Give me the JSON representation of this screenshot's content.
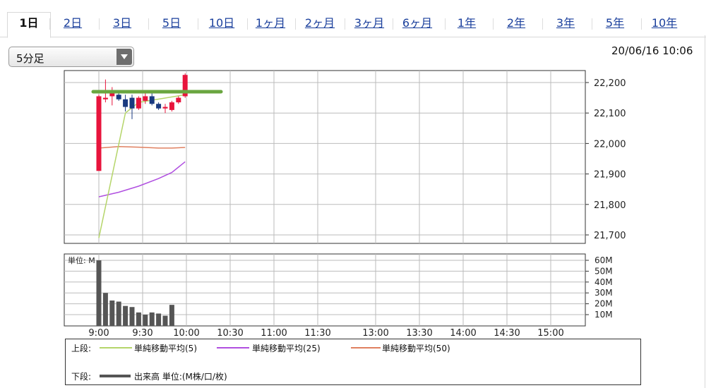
{
  "tabs": [
    {
      "label": "1日",
      "active": true
    },
    {
      "label": "2日"
    },
    {
      "label": "3日"
    },
    {
      "label": "5日"
    },
    {
      "label": "10日"
    },
    {
      "label": "1ヶ月"
    },
    {
      "label": "2ヶ月"
    },
    {
      "label": "3ヶ月"
    },
    {
      "label": "6ヶ月"
    },
    {
      "label": "1年"
    },
    {
      "label": "2年"
    },
    {
      "label": "3年"
    },
    {
      "label": "5年"
    },
    {
      "label": "10年"
    }
  ],
  "interval_select": {
    "value": "5分足"
  },
  "timestamp": "20/06/16 10:06",
  "legend": {
    "upper_label": "上段:",
    "lower_label": "下段:",
    "ma5": "単純移動平均(5)",
    "ma25": "単純移動平均(25)",
    "ma50": "単純移動平均(50)",
    "volume": "出来高 単位:(M株/口/枚)"
  },
  "colors": {
    "up": "#e8143c",
    "down": "#1a3a80",
    "ma5": "#b5d56a",
    "ma25": "#b04fe0",
    "ma50": "#e08060",
    "volume": "#555555",
    "highlight": "#6aa640"
  },
  "chart_data": [
    {
      "type": "candlestick",
      "x_ticks": [
        "9:00",
        "9:30",
        "10:00",
        "10:30",
        "11:00",
        "11:30",
        "13:00",
        "13:30",
        "14:00",
        "14:30",
        "15:00"
      ],
      "y_ticks": [
        "22,200",
        "22,100",
        "22,000",
        "21,900",
        "21,800",
        "21,700"
      ],
      "ylim": [
        21680,
        22240
      ],
      "candles": [
        {
          "t": "9:00",
          "o": 21910,
          "h": 22160,
          "l": 21910,
          "c": 22155
        },
        {
          "t": "9:05",
          "o": 22145,
          "h": 22210,
          "l": 22135,
          "c": 22150
        },
        {
          "t": "9:10",
          "o": 22155,
          "h": 22185,
          "l": 22125,
          "c": 22165
        },
        {
          "t": "9:15",
          "o": 22160,
          "h": 22175,
          "l": 22140,
          "c": 22145
        },
        {
          "t": "9:20",
          "o": 22145,
          "h": 22160,
          "l": 22105,
          "c": 22120
        },
        {
          "t": "9:25",
          "o": 22150,
          "h": 22160,
          "l": 22080,
          "c": 22115
        },
        {
          "t": "9:30",
          "o": 22115,
          "h": 22155,
          "l": 22110,
          "c": 22150
        },
        {
          "t": "9:35",
          "o": 22140,
          "h": 22165,
          "l": 22130,
          "c": 22155
        },
        {
          "t": "9:40",
          "o": 22155,
          "h": 22165,
          "l": 22125,
          "c": 22130
        },
        {
          "t": "9:45",
          "o": 22130,
          "h": 22135,
          "l": 22110,
          "c": 22115
        },
        {
          "t": "9:50",
          "o": 22115,
          "h": 22130,
          "l": 22100,
          "c": 22120
        },
        {
          "t": "9:55",
          "o": 22110,
          "h": 22140,
          "l": 22105,
          "c": 22135
        },
        {
          "t": "10:00",
          "o": 22135,
          "h": 22155,
          "l": 22130,
          "c": 22150
        },
        {
          "t": "10:05",
          "o": 22155,
          "h": 22230,
          "l": 22150,
          "c": 22225
        }
      ],
      "highlight_level": 22170,
      "ma5": [
        [
          0,
          21690
        ],
        [
          4,
          22100
        ],
        [
          6,
          22135
        ],
        [
          13,
          22160
        ]
      ],
      "ma25": [
        [
          0,
          21825
        ],
        [
          3,
          21840
        ],
        [
          6,
          21860
        ],
        [
          9,
          21885
        ],
        [
          11,
          21905
        ],
        [
          13,
          21940
        ]
      ],
      "ma50": [
        [
          0,
          21985
        ],
        [
          3,
          21990
        ],
        [
          6,
          21988
        ],
        [
          9,
          21985
        ],
        [
          11,
          21985
        ],
        [
          13,
          21987
        ]
      ]
    },
    {
      "type": "bar",
      "title": "単位: M",
      "y_ticks": [
        "60M",
        "50M",
        "40M",
        "30M",
        "20M",
        "10M"
      ],
      "ylim": [
        0,
        62
      ],
      "values": [
        60,
        30,
        23,
        22,
        18,
        17,
        12,
        10,
        12,
        11,
        9,
        19
      ]
    }
  ]
}
